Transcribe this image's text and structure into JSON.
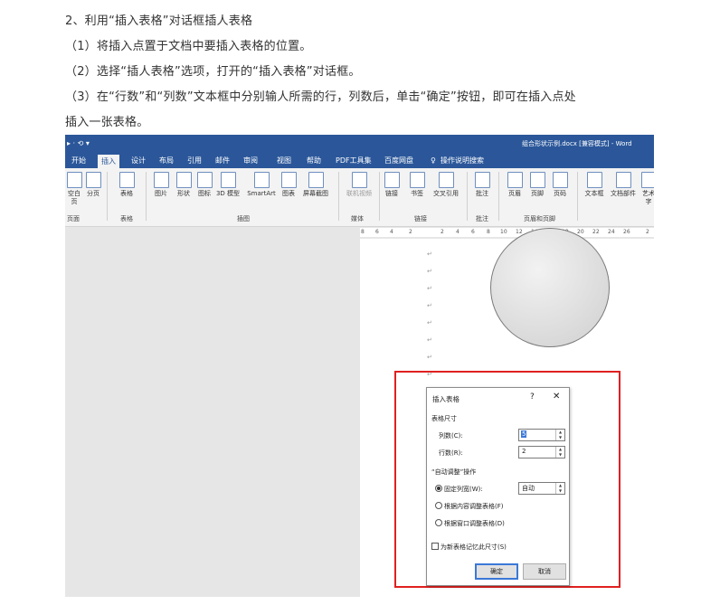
{
  "article": {
    "heading": "2、利用“插入表格”对话框插人表格",
    "step1": "（1）将插入点置于文档中要插入表格的位置。",
    "step2": "（2）选择“插人表格”选项，打开的“插入表格”对话框。",
    "step3a": "（3）在“行数”和“列数”文本框中分别输人所需的行，列数后，单击“确定”按钮，即可在插入点处",
    "step3b": "插入一张表格。"
  },
  "titlebar": {
    "quick_access": "▸ · ⟲  ▾",
    "document": "组合形状示例.docx [兼容模式] - Word"
  },
  "tabs": [
    "开始",
    "插入",
    "设计",
    "布局",
    "引用",
    "邮件",
    "审阅",
    "视图",
    "帮助",
    "PDF工具集",
    "百度网盘"
  ],
  "tell_me": "操作说明搜索",
  "ribbon": {
    "buttons": [
      "空白页",
      "分页",
      "表格",
      "图片",
      "形状",
      "图标",
      "3D 模型",
      "SmartArt",
      "图表",
      "屏幕截图",
      "联机视频",
      "链接",
      "书签",
      "交叉引用",
      "批注",
      "页眉",
      "页脚",
      "页码",
      "文本框",
      "文档部件",
      "艺术字"
    ],
    "groups": [
      "页面",
      "表格",
      "插图",
      "媒体",
      "链接",
      "批注",
      "页眉和页脚"
    ]
  },
  "ruler": [
    "8",
    "6",
    "4",
    "2",
    "2",
    "4",
    "6",
    "8",
    "10",
    "12",
    "14",
    "16",
    "18",
    "20",
    "22",
    "24",
    "26",
    "2"
  ],
  "paragraph_mark": "↵",
  "dialog": {
    "title": "插入表格",
    "help": "?",
    "close": "✕",
    "section_size": "表格尺寸",
    "columns_label": "列数(C):",
    "columns_value": "5",
    "rows_label": "行数(R):",
    "rows_value": "2",
    "section_autofit": "“自动调整”操作",
    "fixed_width_label": "固定列宽(W):",
    "fixed_width_value": "自动",
    "autofit_content": "根据内容调整表格(F)",
    "autofit_window": "根据窗口调整表格(D)",
    "remember": "为新表格记忆此尺寸(S)",
    "ok": "确定",
    "cancel": "取消"
  },
  "colors": {
    "word_blue": "#2b579a",
    "highlight_red": "#e02020"
  }
}
